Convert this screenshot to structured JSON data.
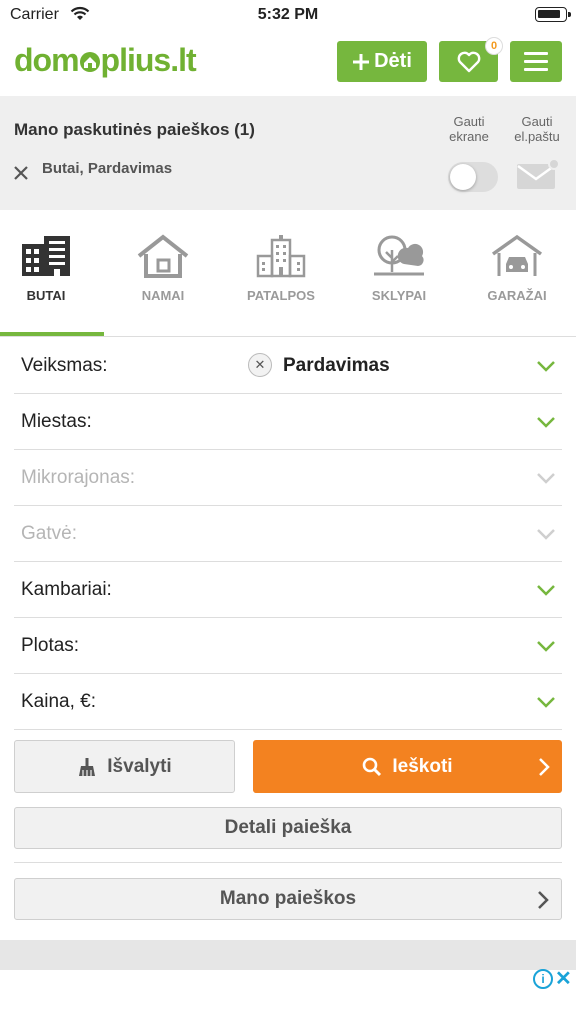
{
  "status_bar": {
    "carrier": "Carrier",
    "time": "5:32 PM"
  },
  "header": {
    "logo_part1": "dom",
    "logo_part2": "plius.lt",
    "add_label": "Dėti",
    "favorites_count": "0",
    "brand_color": "#76b73e"
  },
  "recent_search": {
    "title": "Mano paskutinės paieškos (1)",
    "item": "Butai, Pardavimas",
    "notify_screen_label": [
      "Gauti",
      "ekrane"
    ],
    "notify_email_label": [
      "Gauti",
      "el.paštu"
    ],
    "screen_toggle_on": false
  },
  "categories": [
    {
      "label": "BUTAI",
      "icon": "apartment-icon",
      "active": true
    },
    {
      "label": "NAMAI",
      "icon": "house-icon",
      "active": false
    },
    {
      "label": "PATALPOS",
      "icon": "commercial-building-icon",
      "active": false
    },
    {
      "label": "SKLYPAI",
      "icon": "land-plot-icon",
      "active": false
    },
    {
      "label": "GARAŽAI",
      "icon": "garage-icon",
      "active": false
    }
  ],
  "filters": [
    {
      "label": "Veiksmas:",
      "value": "Pardavimas",
      "enabled": true
    },
    {
      "label": "Miestas:",
      "value": "",
      "enabled": true
    },
    {
      "label": "Mikrorajonas:",
      "value": "",
      "enabled": false
    },
    {
      "label": "Gatvė:",
      "value": "",
      "enabled": false
    },
    {
      "label": "Kambariai:",
      "value": "",
      "enabled": true
    },
    {
      "label": "Plotas:",
      "value": "",
      "enabled": true
    },
    {
      "label": "Kaina, €:",
      "value": "",
      "enabled": true
    }
  ],
  "actions": {
    "clear_label": "Išvalyti",
    "search_label": "Ieškoti",
    "detailed_label": "Detali paieška",
    "my_searches_label": "Mano paieškos",
    "search_color": "#f38220"
  },
  "ad": {
    "info_glyph": "i",
    "close_glyph": "✕"
  }
}
